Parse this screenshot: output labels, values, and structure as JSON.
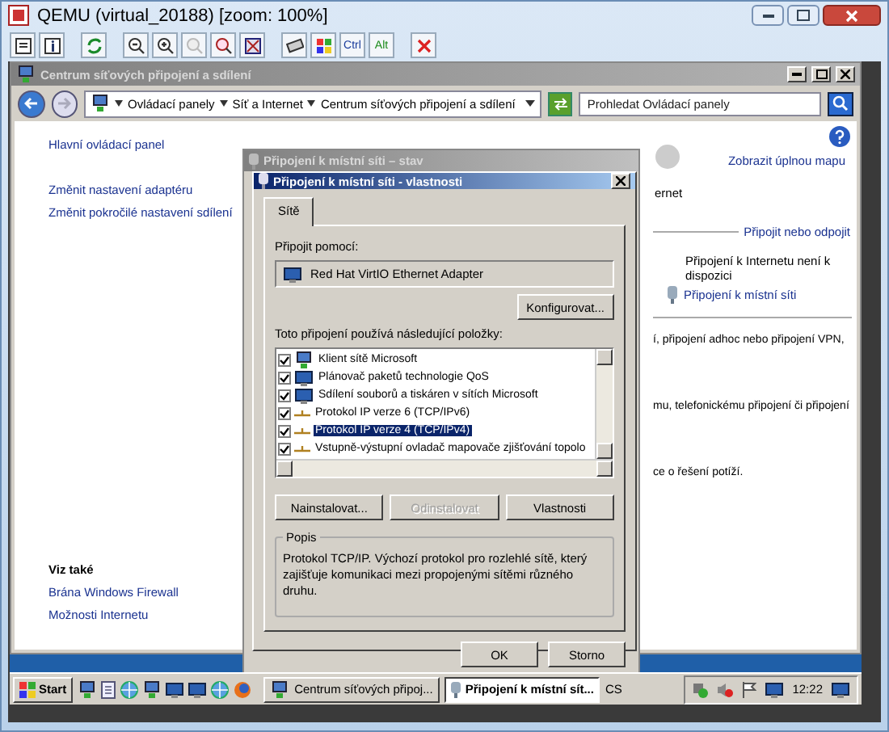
{
  "window": {
    "title": "QEMU (virtual_20188) [zoom: 100%]"
  },
  "toolbar": {
    "keys": [
      "Ctrl",
      "Alt"
    ]
  },
  "explorer": {
    "title": "Centrum síťových připojení a sdílení",
    "breadcrumbs": [
      "Ovládací panely",
      "Síť a Internet",
      "Centrum síťových připojení a sdílení"
    ],
    "search": {
      "placeholder": "Prohledat Ovládací panely"
    },
    "nav_links": [
      "Hlavní ovládací panel",
      "Změnit nastavení adaptéru",
      "Změnit pokročilé nastavení sdílení"
    ],
    "see_also": {
      "heading": "Viz také",
      "links": [
        "Brána Windows Firewall",
        "Možnosti Internetu"
      ]
    },
    "map_link": "Zobrazit úplnou mapu",
    "internet_label": "ernet",
    "connect_link": "Připojit nebo odpojit",
    "status": "Připojení k Internetu není k dispozici",
    "connection_link": "Připojení k místní síti",
    "partial_lines": [
      "í, připojení adhoc nebo připojení VPN,",
      "mu, telefonickému připojení či připojení",
      "ce o řešení potíží."
    ]
  },
  "status_dialog": {
    "title": "Připojení k místní síti – stav"
  },
  "dialog": {
    "title": "Připojení k místní síti - vlastnosti",
    "tabs": [
      {
        "label": "Sítě",
        "selected": true
      }
    ],
    "connect_using_label": "Připojit pomocí:",
    "adapter": "Red Hat VirtIO Ethernet Adapter",
    "configure_button": "Konfigurovat...",
    "items_label": "Toto připojení používá následující položky:",
    "items": [
      {
        "label": "Klient sítě Microsoft",
        "checked": true,
        "selected": false,
        "kind": "client"
      },
      {
        "label": "Plánovač paketů technologie QoS",
        "checked": true,
        "selected": false,
        "kind": "service"
      },
      {
        "label": "Sdílení souborů a tiskáren v sítích Microsoft",
        "checked": true,
        "selected": false,
        "kind": "service"
      },
      {
        "label": "Protokol IP verze 6 (TCP/IPv6)",
        "checked": true,
        "selected": false,
        "kind": "protocol"
      },
      {
        "label": "Protokol IP verze 4 (TCP/IPv4)",
        "checked": true,
        "selected": true,
        "kind": "protocol"
      },
      {
        "label": "Vstupně-výstupní ovladač mapovače zjišťování topolo",
        "checked": true,
        "selected": false,
        "kind": "protocol"
      }
    ],
    "buttons": [
      {
        "label": "Nainstalovat...",
        "disabled": false
      },
      {
        "label": "Odinstalovat",
        "disabled": true
      },
      {
        "label": "Vlastnosti",
        "disabled": false
      }
    ],
    "description": {
      "heading": "Popis",
      "text": "Protokol TCP/IP. Výchozí protokol pro rozlehlé sítě, který zajišťuje komunikaci mezi propojenými sítěmi různého druhu."
    },
    "footer_buttons": [
      "OK",
      "Storno"
    ]
  },
  "taskbar": {
    "start": "Start",
    "tasks": [
      {
        "label": "Centrum síťových připoj...",
        "selected": false
      },
      {
        "label": "Připojení k místní sít...",
        "selected": true
      }
    ],
    "language": "CS",
    "clock": "12:22"
  }
}
